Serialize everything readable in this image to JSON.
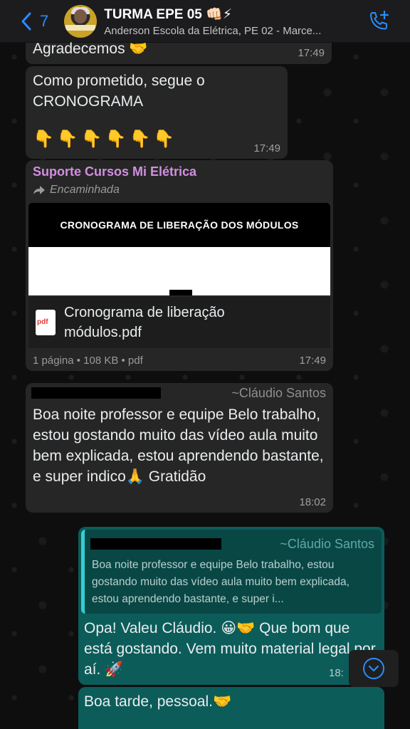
{
  "header": {
    "back_count": "7",
    "title": "TURMA EPE 05 👊🏻⚡",
    "subtitle": "Anderson Escola da Elétrica, PE 02 - Marce..."
  },
  "messages": [
    {
      "text": "Agradecemos 🤝",
      "time": "17:49"
    },
    {
      "text": "Como prometido, segue o CRONOGRAMA",
      "emojis": "👇👇👇👇👇👇",
      "time": "17:49"
    },
    {
      "sender": "Suporte Cursos Mi Elétrica",
      "forwarded_label": "Encaminhada",
      "preview_title": "CRONOGRAMA DE LIBERAÇÃO DOS MÓDULOS",
      "file_icon": "pdf",
      "file_name": "Cronograma de liberação módulos.pdf",
      "meta": "1 página • 108 KB • pdf",
      "time": "17:49"
    },
    {
      "author": "~Cláudio Santos",
      "text": "Boa noite professor e equipe Belo trabalho,  estou gostando muito das vídeo aula muito bem explicada, estou aprendendo bastante, e super indico🙏 Gratidão",
      "time": "18:02"
    },
    {
      "quote_author": "~Cláudio Santos",
      "quote_text": "Boa noite professor e equipe Belo trabalho,  estou gostando muito das vídeo aula muito bem explicada, estou aprendendo bastante, e super i...",
      "text": "Opa! Valeu Cláudio. 😀🤝 Que bom que está gostando. Vem muito material legal por aí. 🚀",
      "time": "18:"
    },
    {
      "text": "Boa tarde, pessoal.🤝"
    }
  ],
  "colors": {
    "incoming": "#262626",
    "outgoing": "#0c5c5a",
    "accent": "#2a8cff",
    "sender_name": "#d28fe0"
  }
}
